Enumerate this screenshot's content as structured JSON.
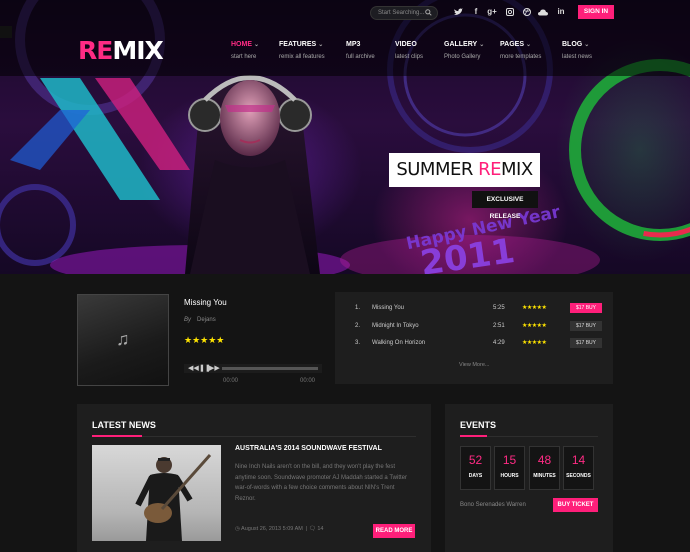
{
  "brand": {
    "logo_accent": "RE",
    "logo_rest": "MIX"
  },
  "header": {
    "search_placeholder": "Start Searching...",
    "signin_label": "SIGN IN",
    "social": [
      "twitter-icon",
      "facebook-icon",
      "google-plus-icon",
      "instagram-icon",
      "dribbble-icon",
      "cloud-icon",
      "linkedin-icon"
    ]
  },
  "nav": [
    {
      "label": "HOME",
      "sub": "start here",
      "dropdown": true,
      "active": true
    },
    {
      "label": "FEATURES",
      "sub": "remix all features",
      "dropdown": true,
      "active": false
    },
    {
      "label": "MP3",
      "sub": "full archive",
      "dropdown": false,
      "active": false
    },
    {
      "label": "VIDEO",
      "sub": "latest clips",
      "dropdown": false,
      "active": false
    },
    {
      "label": "GALLERY",
      "sub": "Photo Gallery",
      "dropdown": true,
      "active": false
    },
    {
      "label": "PAGES",
      "sub": "more templates",
      "dropdown": true,
      "active": false
    },
    {
      "label": "BLOG",
      "sub": "latest news",
      "dropdown": true,
      "active": false
    }
  ],
  "slide": {
    "title_lead": "SUMMER ",
    "title_accent": "RE",
    "title_rest": "MIX",
    "subtitle": "EXCLUSIVE RELEASE"
  },
  "player": {
    "track": "Missing You",
    "by_label": "By",
    "artist": "Dejans",
    "rating": 5,
    "time_current": "00:00",
    "time_total": "00:00"
  },
  "playlist": {
    "rows": [
      {
        "num": "1.",
        "name": "Missing You",
        "duration": "5:25",
        "rating": 5,
        "price": "$17 BUY",
        "highlight": true
      },
      {
        "num": "2.",
        "name": "Midnight In Tokyo",
        "duration": "2:51",
        "rating": 5,
        "price": "$17 BUY",
        "highlight": false
      },
      {
        "num": "3.",
        "name": "Walking On Horizon",
        "duration": "4:29",
        "rating": 5,
        "price": "$17 BUY",
        "highlight": false
      }
    ],
    "view_more": "View More..."
  },
  "news": {
    "section_title": "LATEST NEWS",
    "title": "AUSTRALIA'S 2014 SOUNDWAVE FESTIVAL",
    "body": "Nine Inch Nails aren't on the bill, and they won't play the fest anytime soon. Soundwave promoter AJ Maddah started a Twitter war-of-words with a few choice comments about NIN's Trent Reznor.",
    "date": "August 26, 2013 5:09 AM",
    "comments": "14",
    "read_more": "READ MORE"
  },
  "events": {
    "section_title": "EVENTS",
    "countdown": [
      {
        "value": "52",
        "unit": "DAYS"
      },
      {
        "value": "15",
        "unit": "HOURS"
      },
      {
        "value": "48",
        "unit": "MINUTES"
      },
      {
        "value": "14",
        "unit": "SECONDS"
      }
    ],
    "event_name": "Bono Serenades Warren",
    "buy_label": "BUY TICKET"
  },
  "colors": {
    "accent": "#ff1f7a",
    "star": "#ffe400",
    "background": "#141414",
    "panel": "#1e1e1e"
  }
}
